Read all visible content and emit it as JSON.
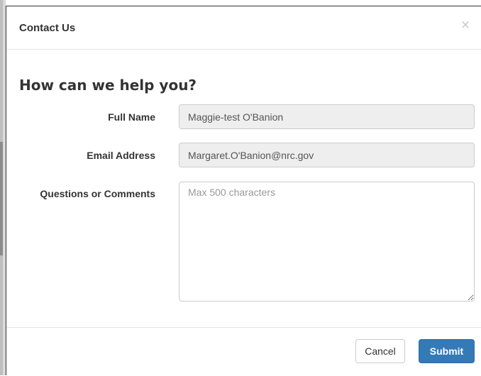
{
  "modal": {
    "title": "Contact Us",
    "close_glyph": "×",
    "heading": "How can we help you?"
  },
  "form": {
    "full_name": {
      "label": "Full Name",
      "value": "Maggie-test O'Banion"
    },
    "email": {
      "label": "Email Address",
      "value": "Margaret.O'Banion@nrc.gov"
    },
    "comments": {
      "label": "Questions or Comments",
      "value": "",
      "placeholder": "Max 500 characters"
    }
  },
  "footer": {
    "cancel_label": "Cancel",
    "submit_label": "Submit"
  },
  "colors": {
    "primary": "#337ab7",
    "readonly_bg": "#eeeeee",
    "text": "#333333"
  }
}
